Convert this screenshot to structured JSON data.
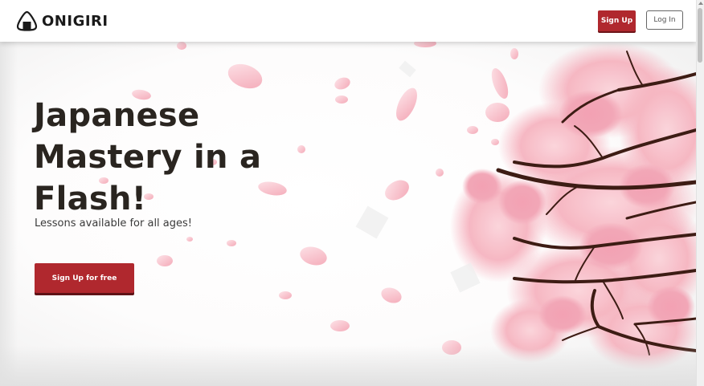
{
  "header": {
    "brand": "ONIGIRI",
    "logo_icon": "onigiri-icon",
    "signup_label": "Sign Up",
    "login_label": "Log In"
  },
  "hero": {
    "headline_lines": [
      "Japanese",
      "Mastery in a",
      "Flash!"
    ],
    "subtitle": "Lessons available for all ages!",
    "cta_label": "Sign Up for free",
    "illustration": "cherry-blossom-branch"
  },
  "colors": {
    "brand_red": "#b0282e",
    "headline": "#2a2520",
    "blossom_pink": "#f6b4c0",
    "branch": "#3d1c14"
  }
}
